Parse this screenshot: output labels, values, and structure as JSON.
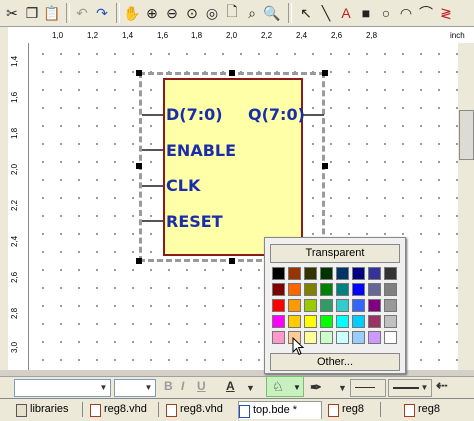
{
  "rulers": {
    "unit": "inch",
    "h_ticks": [
      "1,0",
      "1,2",
      "1,4",
      "1,6",
      "1,8",
      "2,0",
      "2,2",
      "2,4",
      "2,6",
      "2,8"
    ],
    "v_ticks": [
      "1,4",
      "1,6",
      "1,8",
      "2,0",
      "2,2",
      "2,4",
      "2,6",
      "2,8",
      "3,0"
    ]
  },
  "symbol": {
    "ports_left": [
      "D(7:0)",
      "ENABLE",
      "CLK",
      "RESET"
    ],
    "ports_right": [
      "Q(7:0)"
    ],
    "fill": "#ffffa8",
    "border": "#8b1a1a"
  },
  "color_popup": {
    "transparent_label": "Transparent",
    "other_label": "Other...",
    "swatches": [
      "#000000",
      "#993300",
      "#333300",
      "#003300",
      "#003366",
      "#000080",
      "#333399",
      "#333333",
      "#800000",
      "#ff6600",
      "#808000",
      "#008000",
      "#008080",
      "#0000ff",
      "#666699",
      "#808080",
      "#ff0000",
      "#ff9900",
      "#99cc00",
      "#339966",
      "#33cccc",
      "#3366ff",
      "#800080",
      "#999999",
      "#ff00ff",
      "#ffcc00",
      "#ffff00",
      "#00ff00",
      "#00ffff",
      "#00ccff",
      "#993366",
      "#c0c0c0",
      "#ff99cc",
      "#ffcc99",
      "#ffff99",
      "#ccffcc",
      "#ccffff",
      "#99ccff",
      "#cc99ff",
      "#ffffff"
    ]
  },
  "tabs": [
    {
      "label": "libraries",
      "icon": "library-icon"
    },
    {
      "label": "reg8.vhd",
      "icon": "vhdl-file-icon"
    },
    {
      "label": "reg8.vhd",
      "icon": "vhdl-file-icon"
    },
    {
      "label": "top.bde *",
      "icon": "block-diagram-icon"
    },
    {
      "label": "reg8",
      "icon": "symbol-icon"
    },
    {
      "label": "reg8",
      "icon": "symbol-icon"
    }
  ],
  "format_bar": {
    "bold": "B",
    "italic": "I",
    "underline": "U",
    "font_color_glyph": "A"
  }
}
